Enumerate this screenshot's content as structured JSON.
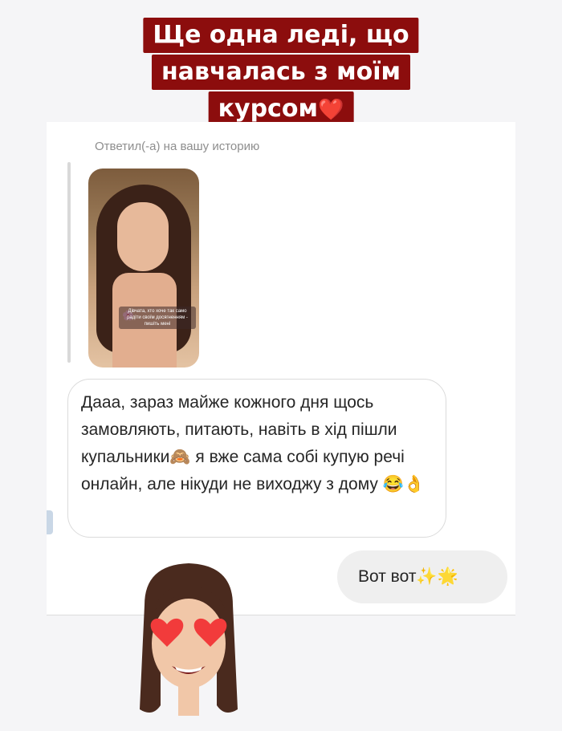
{
  "banner": {
    "line1": "Ще одна леді, що",
    "line2": "навчалась з моїм",
    "line3": "курсом",
    "heart_icon": "❤️",
    "bg_color": "#8c0d0d"
  },
  "dm": {
    "replied_label": "Ответил(-а) на вашу историю",
    "story_caption": "Дівчата, хто хоче так само радіти своїм досягненням - пишіть мені",
    "incoming_message": "Дааа, зараз майже кожного дня щось замовляють, питають, навіть в хід пішли купальники🙈 я вже сама собі купую речі онлайн, але нікуди не виходжу з дому 😂👌",
    "outgoing_message": "Вот вот✨🌟"
  },
  "sticker": {
    "name": "memoji-heart-eyes-sticker"
  }
}
